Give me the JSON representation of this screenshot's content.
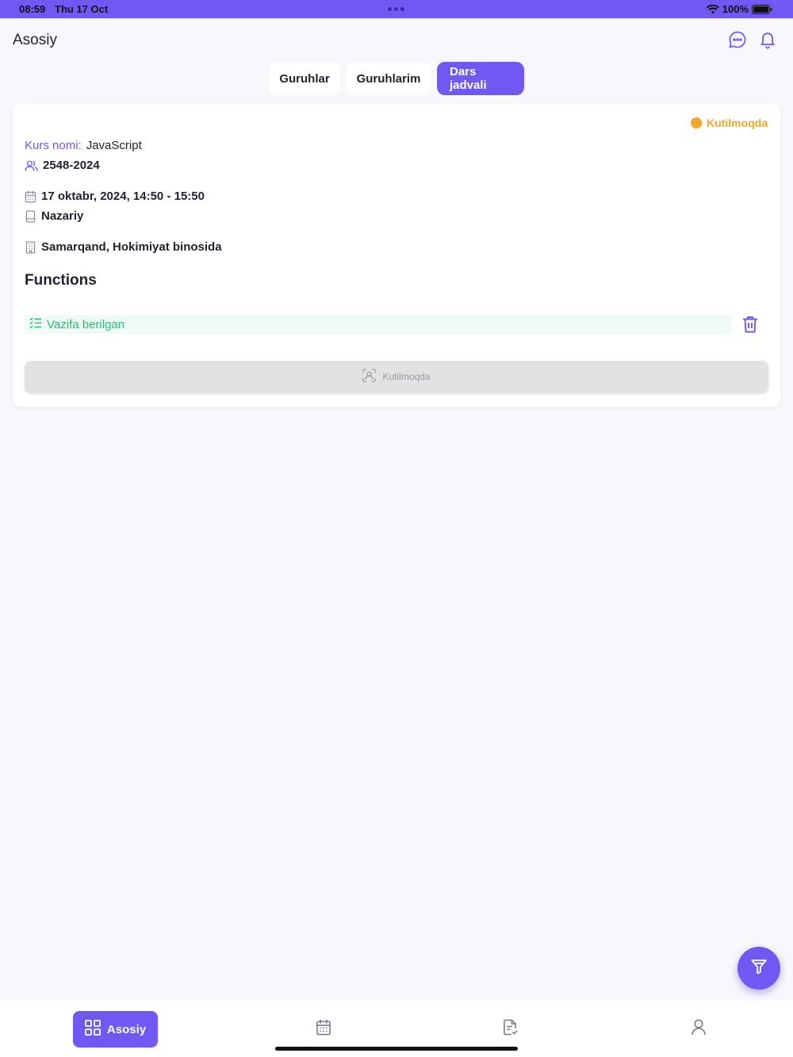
{
  "status_bar": {
    "time": "08:59",
    "date": "Thu 17 Oct",
    "battery": "100%"
  },
  "header": {
    "title": "Asosiy"
  },
  "tabs": [
    {
      "label": "Guruhlar",
      "active": false
    },
    {
      "label": "Guruhlarim",
      "active": false
    },
    {
      "label": "Dars jadvali",
      "active": true
    }
  ],
  "card": {
    "status": "Kutilmoqda",
    "course_label": "Kurs nomi:",
    "course_name": "JavaScript",
    "group": "2548-2024",
    "datetime": "17 oktabr, 2024, 14:50 - 15:50",
    "lesson_type": "Nazariy",
    "location": "Samarqand, Hokimiyat binosida",
    "functions_title": "Functions",
    "task_label": "Vazifa berilgan",
    "wait_button": "Kutilmoqda"
  },
  "bottom_nav": {
    "home_label": "Asosiy"
  },
  "colors": {
    "accent": "#7059f2",
    "pending": "#f4a62a",
    "success": "#22c07a"
  }
}
